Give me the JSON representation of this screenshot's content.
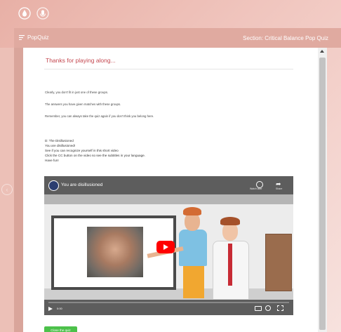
{
  "window": {
    "icons": [
      "droplet-icon",
      "microphone-icon"
    ]
  },
  "header": {
    "app_name": "PopQuiz",
    "section_label": "Section: Critical Balance Pop Quiz"
  },
  "quiz": {
    "title": "Thanks for playing along...",
    "paragraphs": [
      "Clearly, you don't fit in just one of these groups.",
      "The answers you have given matches with these groups.",
      "Remember, you can always take the quiz again if you don't think you belong here."
    ],
    "result_lines": [
      "D: The Disillusioned",
      "You are disillusioned!",
      "See if you can recognize yourself in this short video",
      "Click the CC button on the video so see the subtitles in your language.",
      "Have fun!"
    ]
  },
  "video": {
    "title": "You are disillusioned",
    "watch_later_label": "Watch later",
    "share_label": "Share",
    "time": "0:00"
  },
  "footer": {
    "close_button_label": "Close the quiz"
  },
  "colors": {
    "accent": "#c4474f",
    "header": "#e0aaa0",
    "close_button": "#4cc14a",
    "youtube_red": "#ff0000"
  }
}
